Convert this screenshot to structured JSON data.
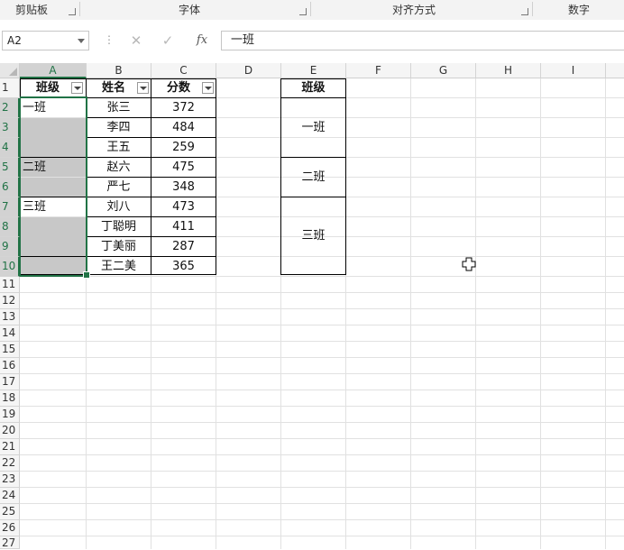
{
  "ribbon": {
    "groups": [
      {
        "label": "剪贴板"
      },
      {
        "label": "字体"
      },
      {
        "label": "对齐方式"
      },
      {
        "label": "数字"
      }
    ]
  },
  "formula_bar": {
    "name_box": "A2",
    "formula": "一班",
    "fx_label": "fx"
  },
  "columns": [
    "A",
    "B",
    "C",
    "D",
    "E",
    "F",
    "G",
    "H",
    "I"
  ],
  "rows": [
    "1",
    "2",
    "3",
    "4",
    "5",
    "6",
    "7",
    "8",
    "9",
    "10",
    "11",
    "12",
    "13",
    "14",
    "15",
    "16",
    "17",
    "18",
    "19",
    "20",
    "21",
    "22",
    "23",
    "24",
    "25",
    "26",
    "27"
  ],
  "table": {
    "headers": {
      "a": "班级",
      "b": "姓名",
      "c": "分数"
    },
    "col_a": [
      "一班",
      "",
      "",
      "二班",
      "",
      "三班",
      "",
      "",
      ""
    ],
    "names": [
      "张三",
      "李四",
      "王五",
      "赵六",
      "严七",
      "刘八",
      "丁聪明",
      "丁美丽",
      "王二美"
    ],
    "scores": [
      "372",
      "484",
      "259",
      "475",
      "348",
      "473",
      "411",
      "287",
      "365"
    ]
  },
  "summary": {
    "header": "班级",
    "groups": [
      "一班",
      "二班",
      "三班"
    ]
  },
  "selection": {
    "range": "A2:A10",
    "accent": "#217346"
  }
}
